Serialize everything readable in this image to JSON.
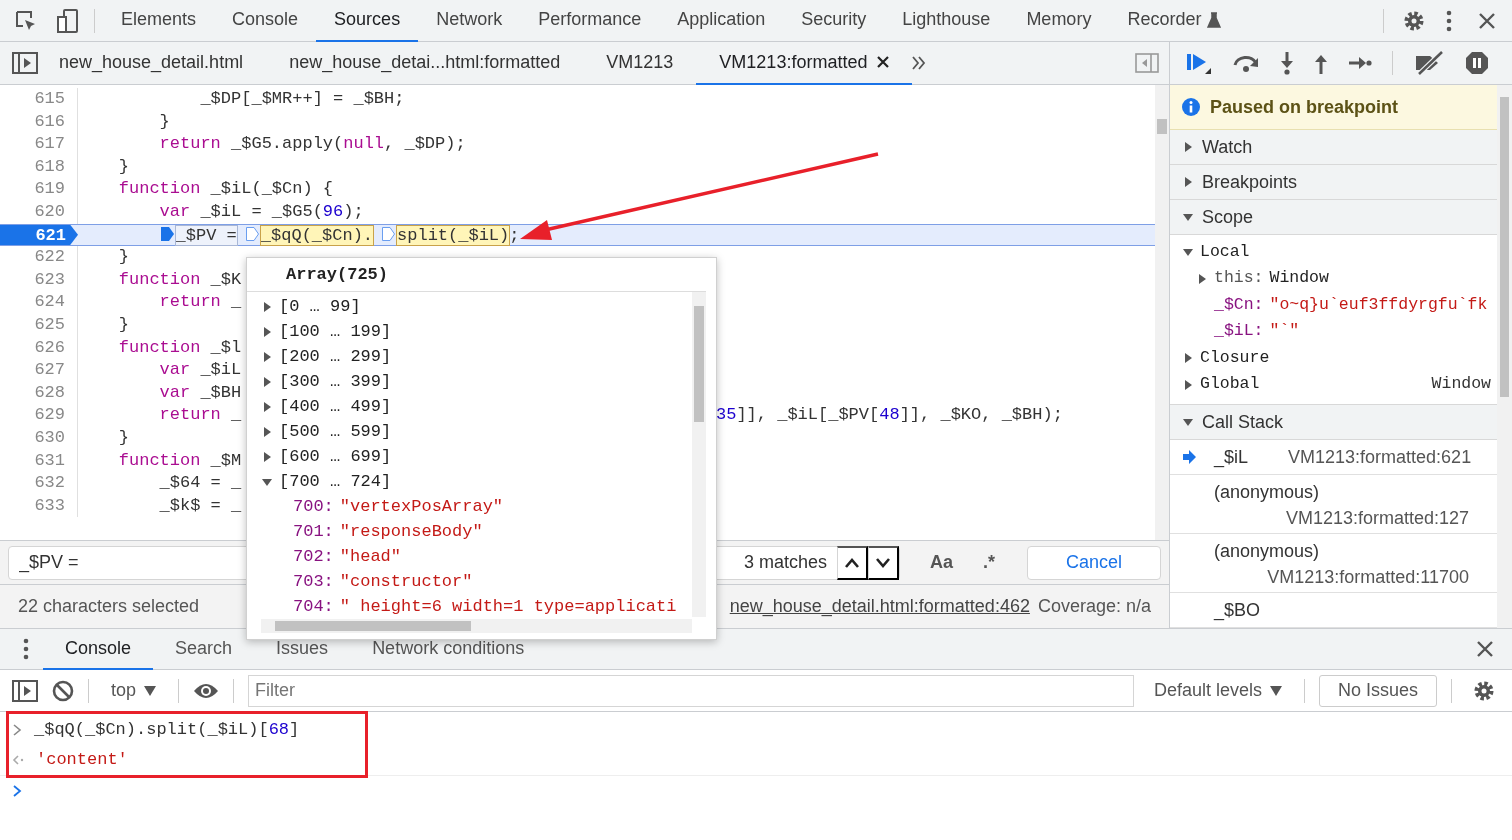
{
  "main_tabs": [
    {
      "label": "Elements",
      "selected": false,
      "kind": "plain"
    },
    {
      "label": "Console",
      "selected": false,
      "kind": "plain"
    },
    {
      "label": "Sources",
      "selected": true,
      "kind": "plain"
    },
    {
      "label": "Network",
      "selected": false,
      "kind": "plain"
    },
    {
      "label": "Performance",
      "selected": false,
      "kind": "plain"
    },
    {
      "label": "Application",
      "selected": false,
      "kind": "plain"
    },
    {
      "label": "Security",
      "selected": false,
      "kind": "plain"
    },
    {
      "label": "Lighthouse",
      "selected": false,
      "kind": "plain"
    },
    {
      "label": "Memory",
      "selected": false,
      "kind": "plain"
    },
    {
      "label": "Recorder",
      "selected": false,
      "kind": "experimental"
    }
  ],
  "file_tabs": [
    {
      "label": "new_house_detail.html",
      "selected": false,
      "closable": false
    },
    {
      "label": "new_house_detai...html:formatted",
      "selected": false,
      "closable": false
    },
    {
      "label": "VM1213",
      "selected": false,
      "closable": false
    },
    {
      "label": "VM1213:formatted",
      "selected": true,
      "closable": true
    }
  ],
  "code": {
    "lines": [
      {
        "number": "615",
        "current": false,
        "tokens": [
          {
            "kind": "plain",
            "text": "            _$DP[_$MR++] = _$BH;"
          }
        ]
      },
      {
        "number": "616",
        "current": false,
        "tokens": [
          {
            "kind": "plain",
            "text": "        }"
          }
        ]
      },
      {
        "number": "617",
        "current": false,
        "tokens": [
          {
            "kind": "keyword",
            "text": "        return"
          },
          {
            "kind": "plain",
            "text": " _$G5.apply("
          },
          {
            "kind": "keyword",
            "text": "null"
          },
          {
            "kind": "plain",
            "text": ", _$DP);"
          }
        ]
      },
      {
        "number": "618",
        "current": false,
        "tokens": [
          {
            "kind": "plain",
            "text": "    }"
          }
        ]
      },
      {
        "number": "619",
        "current": false,
        "tokens": [
          {
            "kind": "keyword",
            "text": "    function"
          },
          {
            "kind": "plain",
            "text": " _$iL(_$Cn) {"
          }
        ]
      },
      {
        "number": "620",
        "current": false,
        "tokens": [
          {
            "kind": "keyword",
            "text": "        var"
          },
          {
            "kind": "plain",
            "text": " _$iL = _$G5("
          },
          {
            "kind": "number",
            "text": "96"
          },
          {
            "kind": "plain",
            "text": ");"
          }
        ]
      },
      {
        "number": "621",
        "current": true,
        "tokens": [
          {
            "kind": "marker",
            "active": true
          },
          {
            "kind": "boxed",
            "text": "_$PV ="
          },
          {
            "kind": "marker",
            "active": false
          },
          {
            "kind": "highlight",
            "text": "_$qQ(_$Cn)."
          },
          {
            "kind": "marker",
            "active": false
          },
          {
            "kind": "highlight",
            "text": "split(_$iL)"
          },
          {
            "kind": "plain",
            "text": ";"
          }
        ]
      },
      {
        "number": "622",
        "current": false,
        "tokens": [
          {
            "kind": "plain",
            "text": "    }"
          }
        ]
      },
      {
        "number": "623",
        "current": false,
        "tokens": [
          {
            "kind": "keyword",
            "text": "    function"
          },
          {
            "kind": "plain",
            "text": " _$K"
          }
        ]
      },
      {
        "number": "624",
        "current": false,
        "tokens": [
          {
            "kind": "keyword",
            "text": "        return"
          },
          {
            "kind": "plain",
            "text": " _"
          }
        ]
      },
      {
        "number": "625",
        "current": false,
        "tokens": [
          {
            "kind": "plain",
            "text": "    }"
          }
        ]
      },
      {
        "number": "626",
        "current": false,
        "tokens": [
          {
            "kind": "keyword",
            "text": "    function"
          },
          {
            "kind": "plain",
            "text": " _$l"
          }
        ]
      },
      {
        "number": "627",
        "current": false,
        "tokens": [
          {
            "kind": "keyword",
            "text": "        var"
          },
          {
            "kind": "plain",
            "text": " _$iL"
          }
        ]
      },
      {
        "number": "628",
        "current": false,
        "tokens": [
          {
            "kind": "keyword",
            "text": "        var"
          },
          {
            "kind": "plain",
            "text": " _$BH"
          }
        ]
      },
      {
        "number": "629",
        "current": false,
        "tokens": [
          {
            "kind": "keyword",
            "text": "        return"
          },
          {
            "kind": "plain",
            "text": " _"
          }
        ],
        "tail": [
          {
            "kind": "number",
            "text": "35"
          },
          {
            "kind": "plain",
            "text": "]], _$iL[_$PV["
          },
          {
            "kind": "number",
            "text": "48"
          },
          {
            "kind": "plain",
            "text": "]], _$KO, _$BH);"
          }
        ]
      },
      {
        "number": "630",
        "current": false,
        "tokens": [
          {
            "kind": "plain",
            "text": "    }"
          }
        ]
      },
      {
        "number": "631",
        "current": false,
        "tokens": [
          {
            "kind": "keyword",
            "text": "    function"
          },
          {
            "kind": "plain",
            "text": " _$M"
          }
        ]
      },
      {
        "number": "632",
        "current": false,
        "tokens": [
          {
            "kind": "plain",
            "text": "        _$64 = _"
          }
        ]
      },
      {
        "number": "633",
        "current": false,
        "tokens": [
          {
            "kind": "plain",
            "text": "        _$k$ = _"
          }
        ]
      }
    ]
  },
  "popover": {
    "title": "Array(725)",
    "groups": [
      {
        "label": "[0 … 99]",
        "expanded": false
      },
      {
        "label": "[100 … 199]",
        "expanded": false
      },
      {
        "label": "[200 … 299]",
        "expanded": false
      },
      {
        "label": "[300 … 399]",
        "expanded": false
      },
      {
        "label": "[400 … 499]",
        "expanded": false
      },
      {
        "label": "[500 … 599]",
        "expanded": false
      },
      {
        "label": "[600 … 699]",
        "expanded": false
      },
      {
        "label": "[700 … 724]",
        "expanded": true,
        "children": [
          {
            "index": "700:",
            "value": "\"vertexPosArray\""
          },
          {
            "index": "701:",
            "value": "\"responseBody\""
          },
          {
            "index": "702:",
            "value": "\"head\""
          },
          {
            "index": "703:",
            "value": "\"constructor\""
          },
          {
            "index": "704:",
            "value": "\" height=6 width=1 type=applicati"
          }
        ]
      }
    ]
  },
  "search": {
    "query": "_$PV =",
    "matches": "3 matches",
    "case_label": "Aa",
    "regex_label": ".*",
    "cancel": "Cancel"
  },
  "status_bar": {
    "selection": "22 characters selected",
    "location": "new_house_detail.html:formatted:462",
    "coverage": "Coverage: n/a"
  },
  "debugger": {
    "banner": "Paused on breakpoint",
    "sections": [
      {
        "title": "Watch",
        "expanded": false
      },
      {
        "title": "Breakpoints",
        "expanded": false
      },
      {
        "title": "Scope",
        "expanded": true,
        "scopes": [
          {
            "name": "Local",
            "expanded": true,
            "children": [
              {
                "kind": "object",
                "key": "this:",
                "value": "Window",
                "expanded": false
              },
              {
                "kind": "string",
                "key": "_$Cn:",
                "value": "\"o~q}u`euf3ffdyrgfu`fk"
              },
              {
                "kind": "string",
                "key": "_$iL:",
                "value": "\"`\""
              }
            ]
          },
          {
            "name": "Closure",
            "expanded": false
          },
          {
            "name": "Global",
            "expanded": false,
            "value": "Window"
          }
        ]
      },
      {
        "title": "Call Stack",
        "expanded": true,
        "frames": [
          {
            "name": "_$iL",
            "location": "VM1213:formatted:621",
            "selected": true
          },
          {
            "name": "(anonymous)",
            "location": "VM1213:formatted:127",
            "selected": false
          },
          {
            "name": "(anonymous)",
            "location": "VM1213:formatted:11700",
            "selected": false
          },
          {
            "name": "_$BO",
            "selected": false
          }
        ]
      }
    ]
  },
  "drawer_tabs": [
    {
      "label": "Console",
      "selected": true
    },
    {
      "label": "Search",
      "selected": false
    },
    {
      "label": "Issues",
      "selected": false
    },
    {
      "label": "Network conditions",
      "selected": false
    }
  ],
  "console_toolbar": {
    "context": "top",
    "filter_placeholder": "Filter",
    "levels": "Default levels",
    "issues": "No Issues"
  },
  "console": [
    {
      "kind": "input",
      "tokens": [
        {
          "kind": "plain",
          "text": "_$qQ(_$Cn).split(_$iL)["
        },
        {
          "kind": "number",
          "text": "68"
        },
        {
          "kind": "plain",
          "text": "]"
        }
      ]
    },
    {
      "kind": "result",
      "tokens": [
        {
          "kind": "string",
          "text": "'content'"
        }
      ]
    }
  ]
}
